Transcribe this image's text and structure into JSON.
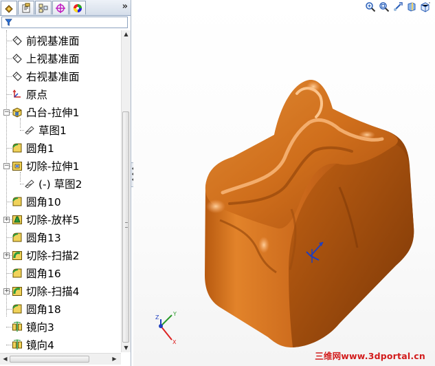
{
  "tabs": [
    {
      "name": "feature-manager-tab",
      "icon": "feature-tree-icon",
      "active": true
    },
    {
      "name": "property-manager-tab",
      "icon": "property-icon",
      "active": false
    },
    {
      "name": "configuration-manager-tab",
      "icon": "configuration-icon",
      "active": false
    },
    {
      "name": "dimxpert-tab",
      "icon": "crosshair-icon",
      "active": false
    },
    {
      "name": "display-manager-tab",
      "icon": "color-wheel-icon",
      "active": false
    }
  ],
  "tabs_more_label": "»",
  "filter_icon": "filter-icon",
  "tree": [
    {
      "label": "前视基准面",
      "icon": "plane-icon"
    },
    {
      "label": "上视基准面",
      "icon": "plane-icon"
    },
    {
      "label": "右视基准面",
      "icon": "plane-icon"
    },
    {
      "label": "原点",
      "icon": "origin-icon"
    },
    {
      "label": "凸台-拉伸1",
      "icon": "extrude-boss-icon",
      "expander": "−"
    },
    {
      "label": "草图1",
      "icon": "sketch-icon"
    },
    {
      "label": "圆角1",
      "icon": "fillet-icon"
    },
    {
      "label": "切除-拉伸1",
      "icon": "extrude-cut-icon",
      "expander": "−"
    },
    {
      "label": "(-) 草图2",
      "icon": "sketch-icon"
    },
    {
      "label": "圆角10",
      "icon": "fillet-icon"
    },
    {
      "label": "切除-放样5",
      "icon": "loft-cut-icon",
      "expander": "+"
    },
    {
      "label": "圆角13",
      "icon": "fillet-icon"
    },
    {
      "label": "切除-扫描2",
      "icon": "sweep-cut-icon",
      "expander": "+"
    },
    {
      "label": "圆角16",
      "icon": "fillet-icon"
    },
    {
      "label": "切除-扫描4",
      "icon": "sweep-cut-icon",
      "expander": "+"
    },
    {
      "label": "圆角18",
      "icon": "fillet-icon"
    },
    {
      "label": "镜向3",
      "icon": "mirror-icon"
    },
    {
      "label": "镜向4",
      "icon": "mirror-icon"
    }
  ],
  "view_toolbar": [
    "zoom-to-fit-icon",
    "zoom-area-icon",
    "previous-view-icon",
    "section-view-icon",
    "view-orientation-icon"
  ],
  "triad_axes": [
    "Y",
    "Z",
    "X"
  ],
  "watermark": "三维网www.3dportal.cn",
  "colors": {
    "model": "#d2721c",
    "highlight": "#f5a860",
    "shadow": "#8a3f08",
    "selection_blue": "#1f3fbf"
  }
}
